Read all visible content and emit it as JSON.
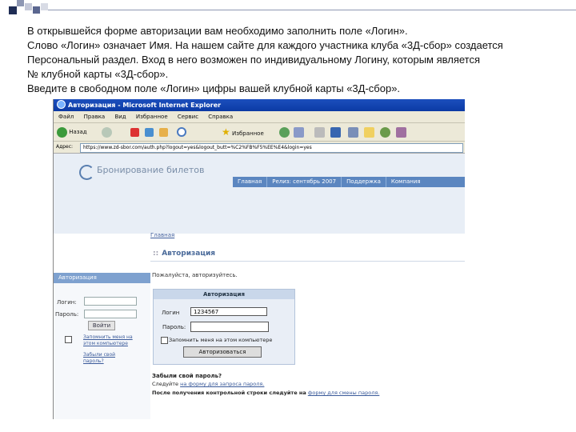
{
  "intro_lines": [
    "В открывшейся форме авторизации вам необходимо заполнить поле «Логин».",
    "Слово «Логин» означает Имя. На нашем сайте для каждого участника клуба «3Д-сбор» создается",
    "Персональный раздел.  Вход  в него возможен по индивидуальному Логину, которым является",
    "№ клубной карты «3Д-сбор».",
    "Введите в свободном поле «Логин» цифры вашей клубной карты «3Д-сбор»."
  ],
  "browser": {
    "title": "Авторизация - Microsoft Internet Explorer",
    "menu": [
      "Файл",
      "Правка",
      "Вид",
      "Избранное",
      "Сервис",
      "Справка"
    ],
    "toolbar": {
      "back": "Назад",
      "favorites": "Избранное"
    },
    "address_label": "Адрес:",
    "address": "https://www.zd-sbor.com/auth.php?logout=yes&logout_butt=%C2%FB%F5%EE%E4&login=yes"
  },
  "site": {
    "logo": "Бронирование билетов",
    "nav": [
      "Главная",
      "Релиз: сентябрь 2007",
      "Поддержка",
      "Компания"
    ],
    "breadcrumb": "Главная",
    "page_title": "Авторизация",
    "please": "Пожалуйста, авторизуйтесь.",
    "sidebar": {
      "header": "Авторизация",
      "login_label": "Логин:",
      "password_label": "Пароль:",
      "submit": "Войти",
      "remember": "Запомнить меня на этом компьютере",
      "forgot": "Забыли свой пароль?"
    },
    "login_box": {
      "header": "Авторизация",
      "login_label": "Логин",
      "login_value": "1234567",
      "password_label": "Пароль:",
      "remember": "Запомнить меня на этом компьютере",
      "submit": "Авторизоваться"
    },
    "forgot": {
      "heading": "Забыли свой пароль?",
      "line1_prefix": "Следуйте",
      "line1_link": "на форму для запроса пароля.",
      "line2_prefix": "После получения контрольной строки следуйте на",
      "line2_link": "форму для смены пароля."
    }
  }
}
